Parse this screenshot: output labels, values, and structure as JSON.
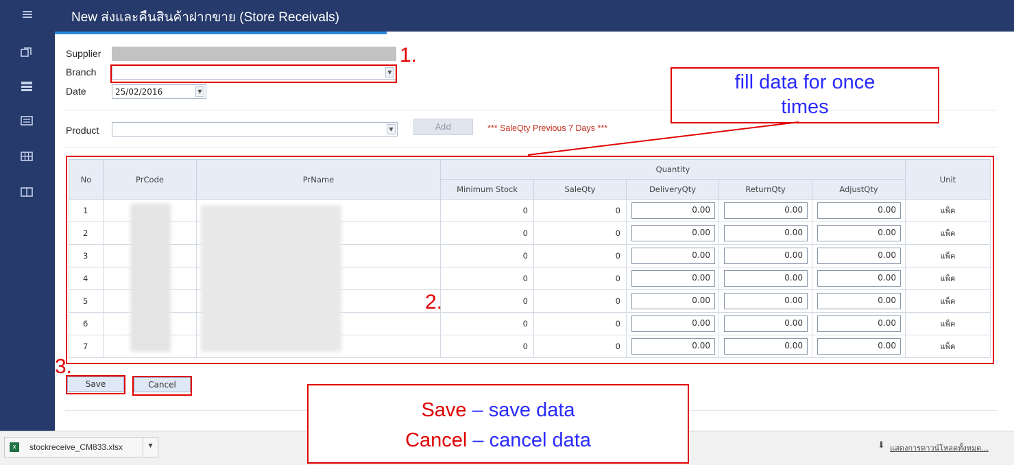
{
  "header": {
    "title": "New ส่งและคืนสินค้าฝากขาย (Store Receivals)"
  },
  "form": {
    "supplier_label": "Supplier",
    "branch_label": "Branch",
    "date_label": "Date",
    "date_value": "25/02/2016",
    "product_label": "Product",
    "add_label": "Add",
    "note": "*** SaleQty Previous 7 Days ***"
  },
  "table": {
    "headers": {
      "no": "No",
      "prcode": "PrCode",
      "prname": "PrName",
      "quantity": "Quantity",
      "minimum_stock": "Minimum Stock",
      "saleqty": "SaleQty",
      "deliveryqty": "DeliveryQty",
      "returnqty": "ReturnQty",
      "adjustqty": "AdjustQty",
      "unit": "Unit"
    },
    "rows": [
      {
        "no": "1",
        "min_stock": "0",
        "saleqty": "0",
        "delivery": "0.00",
        "return": "0.00",
        "adjust": "0.00",
        "unit": "แพ็ค"
      },
      {
        "no": "2",
        "min_stock": "0",
        "saleqty": "0",
        "delivery": "0.00",
        "return": "0.00",
        "adjust": "0.00",
        "unit": "แพ็ค"
      },
      {
        "no": "3",
        "min_stock": "0",
        "saleqty": "0",
        "delivery": "0.00",
        "return": "0.00",
        "adjust": "0.00",
        "unit": "แพ็ค"
      },
      {
        "no": "4",
        "min_stock": "0",
        "saleqty": "0",
        "delivery": "0.00",
        "return": "0.00",
        "adjust": "0.00",
        "unit": "แพ็ค"
      },
      {
        "no": "5",
        "min_stock": "0",
        "saleqty": "0",
        "delivery": "0.00",
        "return": "0.00",
        "adjust": "0.00",
        "unit": "แพ็ค"
      },
      {
        "no": "6",
        "min_stock": "0",
        "saleqty": "0",
        "delivery": "0.00",
        "return": "0.00",
        "adjust": "0.00",
        "unit": "แพ็ค"
      },
      {
        "no": "7",
        "min_stock": "0",
        "saleqty": "0",
        "delivery": "0.00",
        "return": "0.00",
        "adjust": "0.00",
        "unit": "แพ็ค"
      }
    ]
  },
  "buttons": {
    "save": "Save",
    "cancel": "Cancel"
  },
  "download_bar": {
    "filename": "stockreceive_CM833.xlsx",
    "show_all": "แสดงการดาวน์โหลดทั้งหมด..."
  },
  "annotations": {
    "num1": "1.",
    "num2": "2.",
    "num3": "3.",
    "fill_line1": "fill data for once",
    "fill_line2": "times",
    "save_word": "Save",
    "save_desc": " – save data",
    "cancel_word": "Cancel",
    "cancel_desc": " – cancel data"
  },
  "colors": {
    "nav": "#263a6b",
    "accent": "#2b8be0",
    "annotation_red": "#e00000",
    "annotation_blue": "#2a2aff"
  },
  "icons": [
    "menu-icon",
    "copy-icon",
    "list-icon",
    "card-icon",
    "grid-icon",
    "columns-icon",
    "excel-file-icon",
    "download-icon"
  ]
}
